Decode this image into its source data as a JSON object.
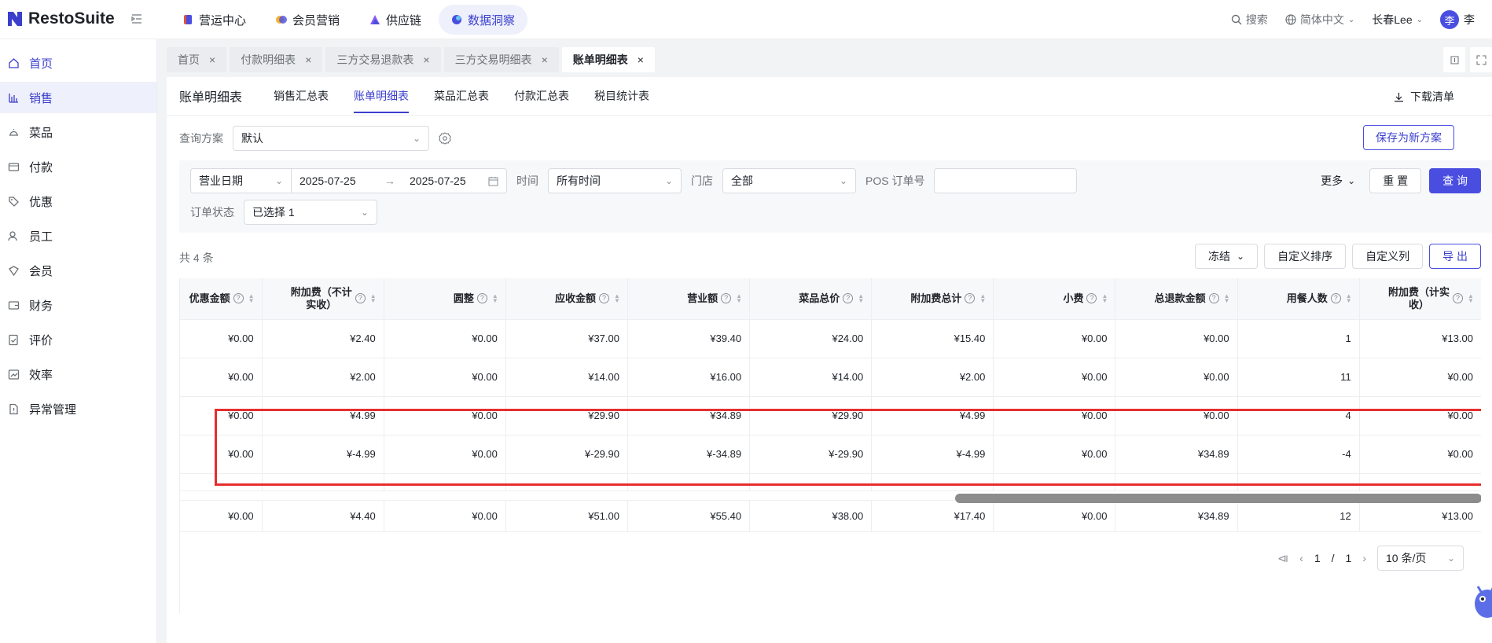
{
  "brand": {
    "name": "RestoSuite",
    "color": "#3b3fcc"
  },
  "topnav": [
    {
      "label": "营运中心",
      "icon": "store-icon",
      "active": false
    },
    {
      "label": "会员营销",
      "icon": "member-icon",
      "active": false
    },
    {
      "label": "供应链",
      "icon": "supply-icon",
      "active": false
    },
    {
      "label": "数据洞察",
      "icon": "insight-icon",
      "active": true
    }
  ],
  "topright": {
    "search": "搜索",
    "language": "简体中文",
    "store": "长春Lee",
    "avatar_letter": "李",
    "user": "李"
  },
  "sidebar": {
    "items": [
      {
        "label": "首页",
        "icon": "home-icon"
      },
      {
        "label": "销售",
        "icon": "chart-icon",
        "active": true
      },
      {
        "label": "菜品",
        "icon": "dish-icon"
      },
      {
        "label": "付款",
        "icon": "payment-icon"
      },
      {
        "label": "优惠",
        "icon": "discount-icon"
      },
      {
        "label": "员工",
        "icon": "staff-icon"
      },
      {
        "label": "会员",
        "icon": "vip-icon"
      },
      {
        "label": "财务",
        "icon": "finance-icon"
      },
      {
        "label": "评价",
        "icon": "review-icon"
      },
      {
        "label": "效率",
        "icon": "efficiency-icon"
      },
      {
        "label": "异常管理",
        "icon": "exception-icon"
      }
    ]
  },
  "tabs": [
    {
      "label": "首页",
      "close": "×"
    },
    {
      "label": "付款明细表",
      "close": "×"
    },
    {
      "label": "三方交易退款表",
      "close": "×"
    },
    {
      "label": "三方交易明细表",
      "close": "×"
    },
    {
      "label": "账单明细表",
      "close": "×",
      "active": true
    }
  ],
  "subtabs": {
    "page_title": "账单明细表",
    "items": [
      "销售汇总表",
      "账单明细表",
      "菜品汇总表",
      "付款汇总表",
      "税目统计表"
    ],
    "active_index": 1,
    "download": "下载清单"
  },
  "scheme": {
    "label": "查询方案",
    "value": "默认",
    "save": "保存为新方案"
  },
  "filters": {
    "date_type": "营业日期",
    "date_start": "2025-07-25",
    "date_end": "2025-07-25",
    "arrow": "→",
    "time_label": "时间",
    "time_value": "所有时间",
    "store_label": "门店",
    "store_value": "全部",
    "pos_label": "POS 订单号",
    "pos_value": "",
    "more": "更多",
    "reset": "重 置",
    "query": "查 询",
    "status_label": "订单状态",
    "status_value": "已选择 1"
  },
  "summary": {
    "count_text": "共 4 条"
  },
  "table_tools": {
    "freeze": "冻结",
    "custom_sort": "自定义排序",
    "custom_cols": "自定义列",
    "export": "导 出"
  },
  "table": {
    "columns": [
      {
        "l1": "优惠金额",
        "l2": ""
      },
      {
        "l1": "附加费（不计",
        "l2": "实收）"
      },
      {
        "l1": "圆整",
        "l2": ""
      },
      {
        "l1": "应收金额",
        "l2": ""
      },
      {
        "l1": "营业额",
        "l2": ""
      },
      {
        "l1": "菜品总价",
        "l2": ""
      },
      {
        "l1": "附加费总计",
        "l2": ""
      },
      {
        "l1": "小费",
        "l2": ""
      },
      {
        "l1": "总退款金额",
        "l2": ""
      },
      {
        "l1": "用餐人数",
        "l2": ""
      },
      {
        "l1": "附加费（计实",
        "l2": "收）"
      }
    ],
    "rows": [
      [
        "¥0.00",
        "¥2.40",
        "¥0.00",
        "¥37.00",
        "¥39.40",
        "¥24.00",
        "¥15.40",
        "¥0.00",
        "¥0.00",
        "1",
        "¥13.00"
      ],
      [
        "¥0.00",
        "¥2.00",
        "¥0.00",
        "¥14.00",
        "¥16.00",
        "¥14.00",
        "¥2.00",
        "¥0.00",
        "¥0.00",
        "11",
        "¥0.00"
      ],
      [
        "¥0.00",
        "¥4.99",
        "¥0.00",
        "¥29.90",
        "¥34.89",
        "¥29.90",
        "¥4.99",
        "¥0.00",
        "¥0.00",
        "4",
        "¥0.00"
      ],
      [
        "¥0.00",
        "¥-4.99",
        "¥0.00",
        "¥-29.90",
        "¥-34.89",
        "¥-29.90",
        "¥-4.99",
        "¥0.00",
        "¥34.89",
        "-4",
        "¥0.00"
      ]
    ],
    "totals": [
      "¥0.00",
      "¥4.40",
      "¥0.00",
      "¥51.00",
      "¥55.40",
      "¥38.00",
      "¥17.40",
      "¥0.00",
      "¥34.89",
      "12",
      "¥13.00"
    ]
  },
  "pagination": {
    "current": "1",
    "sep": "/",
    "total": "1",
    "page_size": "10 条/页"
  }
}
